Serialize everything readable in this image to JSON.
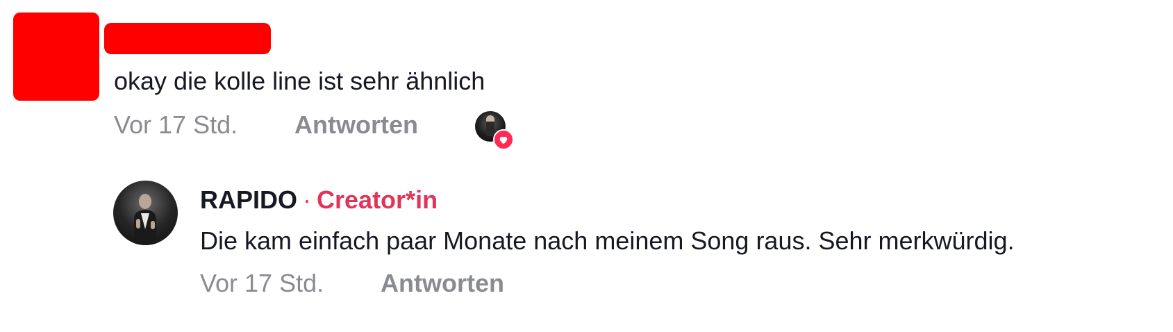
{
  "comment": {
    "text": "okay die kolle line ist sehr ähnlich",
    "time": "Vor 17 Std.",
    "reply_label": "Antworten",
    "creator_liked": true
  },
  "reply": {
    "username": "RAPIDO",
    "separator": "·",
    "badge": "Creator*in",
    "text": "Die kam einfach paar Monate nach meinem Song raus. Sehr merkwürdig.",
    "time": "Vor 17 Std.",
    "reply_label": "Antworten"
  },
  "colors": {
    "redaction": "#ff0000",
    "creator_accent": "#fe2c55",
    "meta_gray": "#8a8b91",
    "text": "#161823"
  },
  "icons": {
    "heart": "heart-icon"
  }
}
